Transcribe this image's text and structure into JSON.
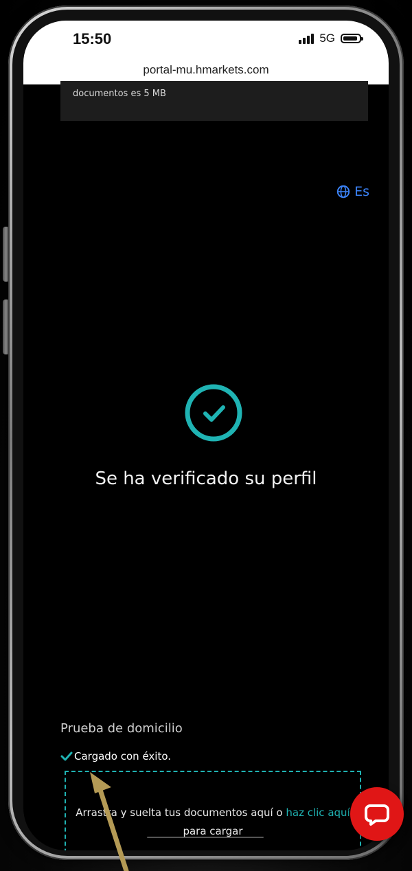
{
  "status_bar": {
    "time": "15:50",
    "network": "5G"
  },
  "browser": {
    "url": "portal-mu.hmarkets.com"
  },
  "info_note": {
    "text": "documentos es 5 MB"
  },
  "language": {
    "label": "Es",
    "icon": "globe-icon"
  },
  "verification": {
    "icon": "check-circle-icon",
    "title": "Se ha verificado su perfil"
  },
  "address_proof": {
    "label": "Prueba de domicilio",
    "status": "Cargado con éxito.",
    "status_icon": "checkmark-icon"
  },
  "dropzone": {
    "text_before_link": "Arrastra y suelta tus documentos aquí o ",
    "link_text": "haz clic aquí",
    "text_after_link": " para cargar"
  },
  "chat": {
    "icon": "chat-bubble-icon"
  },
  "colors": {
    "accent": "#1fb3b3",
    "language": "#3b82f6",
    "chat": "#e01616",
    "annotation_arrow": "#b49a55"
  }
}
